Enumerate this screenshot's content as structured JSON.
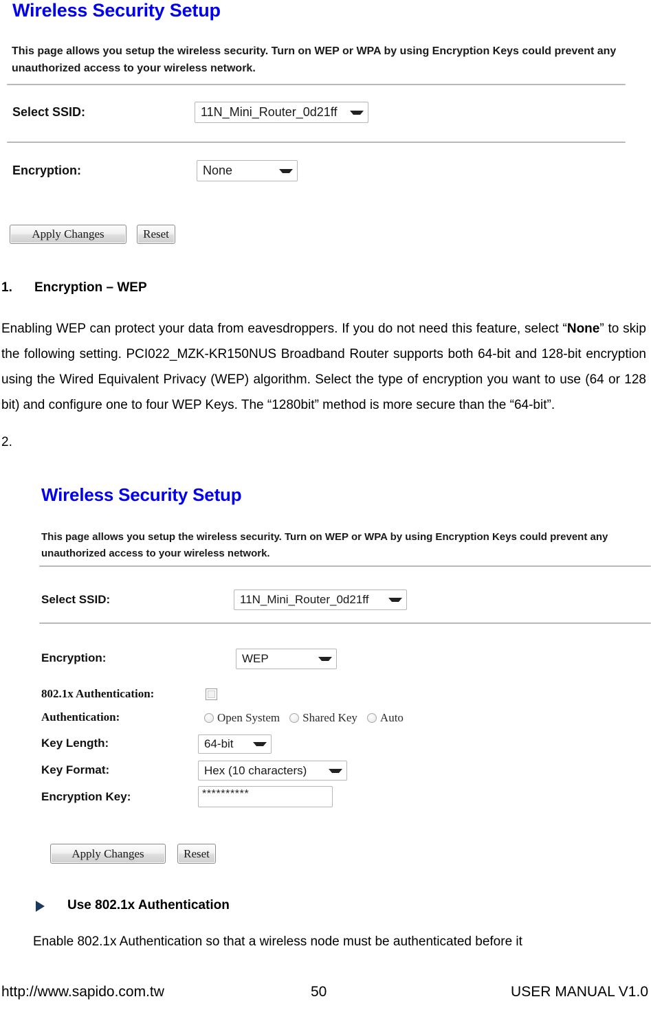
{
  "page": {
    "document_type": "user-manual-page",
    "page_number": "50"
  },
  "panel_none": {
    "title": "Wireless Security Setup",
    "description": "This page allows you setup the wireless security. Turn on WEP or WPA by using Encryption Keys could prevent any unauthorized access to your wireless network.",
    "fields": {
      "ssid_label": "Select SSID:",
      "ssid_value": "11N_Mini_Router_0d21ff",
      "encryption_label": "Encryption:",
      "encryption_value": "None"
    },
    "buttons": {
      "apply": "Apply Changes",
      "reset": "Reset"
    }
  },
  "section_1": {
    "number": "1.",
    "heading": "Encryption – WEP",
    "paragraph": "Enabling WEP can protect your data from eavesdroppers. If you do not need this feature, select “None” to skip the following setting. PCI022_MZK-KR150NUS Broadband Router supports both 64-bit and 128-bit encryption using the Wired Equivalent Privacy (WEP) algorithm. Select the type of encryption you want to use (64 or 128 bit) and configure one to four WEP Keys. The “1280bit” method is more secure than the “64-bit”.",
    "paragraph_bold_term": "None"
  },
  "section_2": {
    "number": "2."
  },
  "panel_wep": {
    "title": "Wireless Security Setup",
    "description": "This page allows you setup the wireless security. Turn on WEP or WPA by using Encryption Keys could prevent any unauthorized access to your wireless network.",
    "fields": {
      "ssid_label": "Select SSID:",
      "ssid_value": "11N_Mini_Router_0d21ff",
      "encryption_label": "Encryption:",
      "encryption_value": "WEP",
      "dot1x_label": "802.1x Authentication:",
      "dot1x_checked": false,
      "authentication_label": "Authentication:",
      "authentication_options": [
        "Open System",
        "Shared Key",
        "Auto"
      ],
      "authentication_selected": "",
      "key_length_label": "Key Length:",
      "key_length_value": "64-bit",
      "key_format_label": "Key Format:",
      "key_format_value": "Hex (10 characters)",
      "encryption_key_label": "Encryption Key:",
      "encryption_key_value": "**********"
    },
    "buttons": {
      "apply": "Apply Changes",
      "reset": "Reset"
    }
  },
  "bullet_section": {
    "heading": "Use 802.1x Authentication",
    "body": "Enable 802.1x Authentication so that a wireless node must be authenticated before it"
  },
  "footer": {
    "url": "http://www.sapido.com.tw",
    "page": "50",
    "manual": "USER MANUAL V1.0"
  },
  "colors": {
    "title_blue": "#0000ee",
    "bullet_navy": "#1b3a5c",
    "rule_gray": "#b9b9b9",
    "control_border": "#b6b6b6"
  }
}
